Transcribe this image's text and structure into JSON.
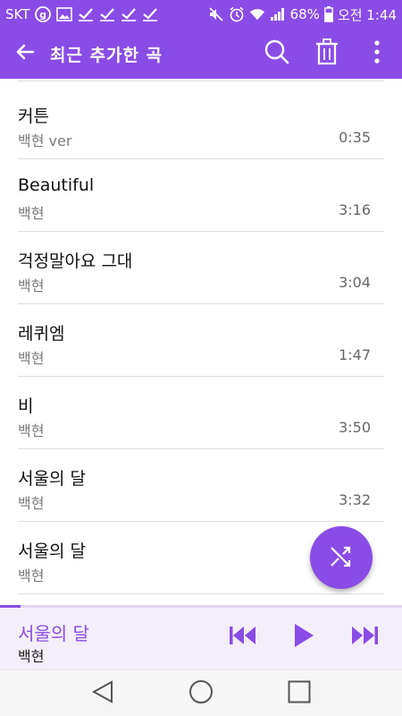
{
  "status_bar": {
    "carrier": "SKT",
    "battery_percent": "68%",
    "time": "오전 1:44",
    "icons_left": [
      "g-badge-icon",
      "gallery-icon",
      "check-icon",
      "check-icon",
      "check-icon",
      "check-icon"
    ],
    "icons_right": [
      "mute-icon",
      "alarm-icon",
      "wifi-icon",
      "signal-icon",
      "battery-icon"
    ]
  },
  "app_bar": {
    "title": "최근 추가한 곡",
    "icons": [
      "back-arrow-icon",
      "search-icon",
      "trash-icon",
      "more-vert-icon"
    ]
  },
  "list": {
    "items": [
      {
        "title": "커튼",
        "artist": "백현 ver",
        "duration": "0:35"
      },
      {
        "title": "Beautiful",
        "artist": "백현",
        "duration": "3:16"
      },
      {
        "title": "걱정말아요 그대",
        "artist": "백현",
        "duration": "3:04"
      },
      {
        "title": "레퀴엠",
        "artist": "백현",
        "duration": "1:47"
      },
      {
        "title": "비",
        "artist": "백현",
        "duration": "3:50"
      },
      {
        "title": "서울의 달",
        "artist": "백현",
        "duration": "3:32"
      },
      {
        "title": "서울의 달",
        "artist": "백현",
        "duration": ""
      }
    ]
  },
  "fab": {
    "icon": "shuffle-icon"
  },
  "mini_player": {
    "title": "서울의 달",
    "artist": "백현",
    "progress_fraction": 0.05,
    "icons": [
      "skip-previous-icon",
      "play-icon",
      "skip-next-icon"
    ]
  },
  "nav_bar": {
    "icons": [
      "nav-back-icon",
      "nav-home-icon",
      "nav-recents-icon"
    ]
  },
  "colors": {
    "accent": "#8a4ce6",
    "player_bg": "#f3eef9"
  }
}
